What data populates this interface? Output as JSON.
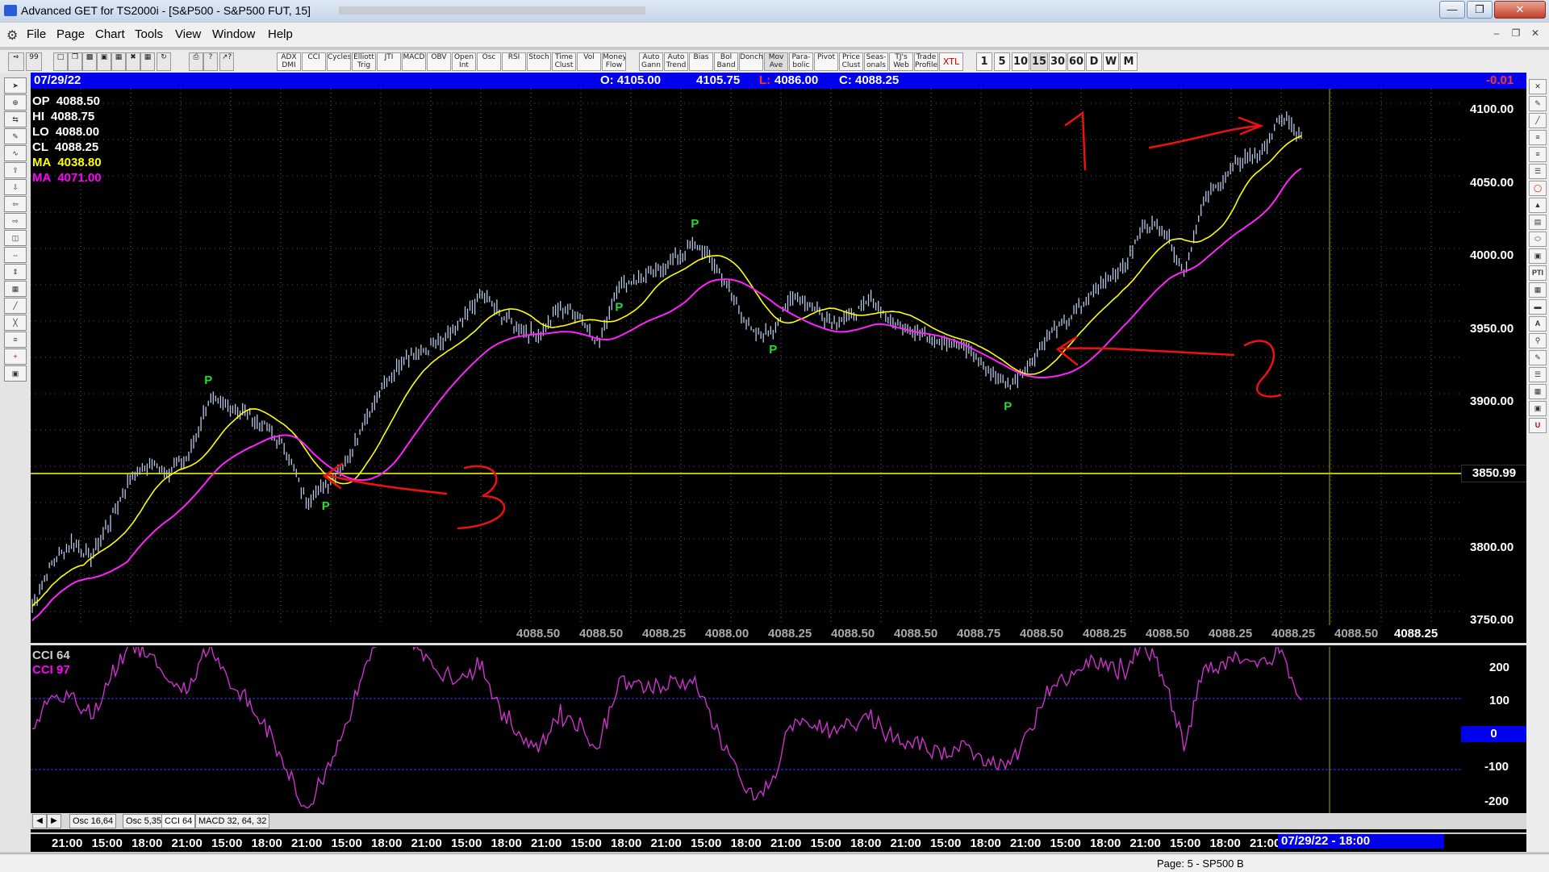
{
  "window": {
    "title": "Advanced GET for TS2000i - [S&P500 - S&P500 FUT, 15]"
  },
  "menu": [
    "File",
    "Page",
    "Chart",
    "Tools",
    "View",
    "Window",
    "Help"
  ],
  "toolbar": {
    "indicators": [
      "ADX DMI",
      "CCI",
      "Cycles",
      "Elliott Trig",
      "JTI",
      "MACD",
      "OBV",
      "Open Int",
      "Osc",
      "RSI",
      "Stoch",
      "Time Clust",
      "Vol",
      "Money Flow",
      "Auto Gann",
      "Auto Trend",
      "Bias",
      "Bol Band",
      "Donch",
      "Mov Ave",
      "Para- bolic",
      "Pivot",
      "Price Clust",
      "Seas- onals",
      "TJ's Web",
      "Trade Profile",
      "XTL"
    ],
    "intervals": [
      "1",
      "5",
      "10",
      "15",
      "30",
      "60",
      "D",
      "W",
      "M"
    ]
  },
  "header": {
    "date": "07/29/22",
    "open": "O: 4105.00",
    "high": "4105.75",
    "low_prefix": "L:",
    "low": "4086.00",
    "close": "C: 4088.25",
    "change": "-0.01"
  },
  "legend": [
    {
      "label": "OP",
      "value": "4088.50",
      "color": "#ffffff"
    },
    {
      "label": "HI",
      "value": "4088.75",
      "color": "#ffffff"
    },
    {
      "label": "LO",
      "value": "4088.00",
      "color": "#ffffff"
    },
    {
      "label": "CL",
      "value": "4088.25",
      "color": "#ffffff"
    },
    {
      "label": "MA",
      "value": "4038.80",
      "color": "#ffff00"
    },
    {
      "label": "MA",
      "value": "4071.00",
      "color": "#ff00ff"
    }
  ],
  "price_axis": [
    "4100.00",
    "4050.00",
    "4000.00",
    "3950.00",
    "3900.00",
    "3800.00",
    "3750.00"
  ],
  "cursor_price": "3850.99",
  "value_row": [
    "4088.50",
    "4088.50",
    "4088.25",
    "4088.00",
    "4088.25",
    "4088.50",
    "4088.50",
    "4088.75",
    "4088.50",
    "4088.25",
    "4088.50",
    "4088.25",
    "4088.25",
    "4088.50"
  ],
  "last_value": "4088.25",
  "pivot_label": "P",
  "annotations": [
    "1",
    "2",
    "3"
  ],
  "cci": {
    "label1": "CCI 64",
    "label2": "CCI  97",
    "axis": [
      "200",
      "100",
      "0",
      "-100",
      "-200"
    ]
  },
  "tabs": [
    "Osc 16,64",
    "Osc 5,35",
    "CCI 64",
    "MACD 32, 64, 32"
  ],
  "time_axis": [
    "21:00",
    "15:00",
    "18:00",
    "21:00",
    "15:00",
    "18:00",
    "21:00",
    "15:00",
    "18:00",
    "21:00",
    "15:00",
    "18:00",
    "21:00",
    "15:00",
    "18:00",
    "21:00",
    "15:00",
    "18:00",
    "21:00",
    "15:00",
    "18:00",
    "21:00",
    "15:00",
    "18:00",
    "21:00",
    "15:00",
    "18:00",
    "21:00",
    "15:00",
    "18:00",
    "21:00"
  ],
  "time_cursor": "07/29/22 - 18:00",
  "status": "Page: 5 - SP500 B",
  "chart_data": {
    "type": "line",
    "title": "",
    "y_range": [
      3740,
      4110
    ],
    "price": [
      3760,
      3790,
      3805,
      3795,
      3820,
      3850,
      3860,
      3855,
      3865,
      3905,
      3900,
      3895,
      3885,
      3870,
      3835,
      3845,
      3860,
      3890,
      3915,
      3935,
      3940,
      3945,
      3960,
      3980,
      3965,
      3955,
      3950,
      3970,
      3965,
      3945,
      3985,
      3990,
      3995,
      4005,
      4015,
      4000,
      3975,
      3950,
      3955,
      3980,
      3970,
      3960,
      3965,
      3975,
      3960,
      3955,
      3950,
      3945,
      3940,
      3925,
      3915,
      3930,
      3950,
      3960,
      3975,
      3990,
      4000,
      4030,
      4025,
      3995,
      4045,
      4060,
      4075,
      4080,
      4105,
      4090
    ]
  }
}
